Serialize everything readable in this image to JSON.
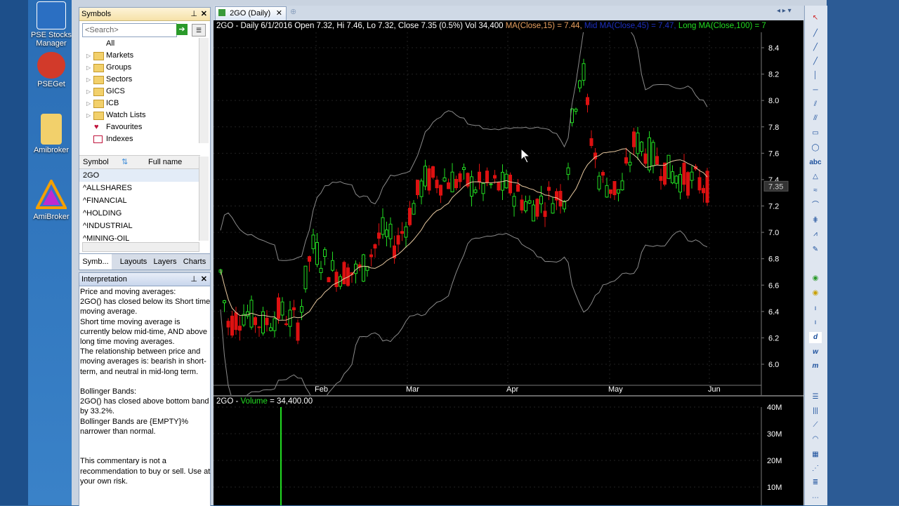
{
  "desktop": {
    "icons": [
      {
        "label": "PSE Stocks Manager",
        "color": "#2b6fc2"
      },
      {
        "label": "PSEGet",
        "color": "#d23a2a"
      },
      {
        "label": "Amibroker",
        "color": "#f2d06b"
      },
      {
        "label": "AmiBroker",
        "color": "#3a70c8"
      }
    ]
  },
  "symbols_panel": {
    "title": "Symbols",
    "search_placeholder": "<Search>",
    "tree": [
      "All",
      "Markets",
      "Groups",
      "Sectors",
      "GICS",
      "ICB",
      "Watch Lists",
      "Favourites",
      "Indexes"
    ],
    "col_symbol": "Symbol",
    "col_fullname": "Full name",
    "rows": [
      "2GO",
      "^ALLSHARES",
      "^FINANCIAL",
      "^HOLDING",
      "^INDUSTRIAL",
      "^MINING-OIL"
    ]
  },
  "tabs": [
    "Symb...",
    "Layouts",
    "Layers",
    "Charts"
  ],
  "interpretation": {
    "title": "Interpretation",
    "text": "Price and moving averages:\n2GO() has closed below its Short time moving average.\nShort time moving average is currently below mid-time, AND above long time moving averages.\nThe relationship between price and moving averages is: bearish in short-term, and neutral in mid-long term.\n\nBollinger Bands:\n2GO() has closed above bottom band by 33.2%.\nBollinger Bands are {EMPTY}% narrower than normal.\n\n\nThis commentary is not a recommendation to buy or sell. Use at your own risk."
  },
  "chart": {
    "tab_title": "2GO (Daily)",
    "header_main": "2GO - Daily 6/1/2016 Open 7.32, Hi 7.46, Lo 7.32, Close 7.35 (0.5%) Vol 34,400",
    "ma_short": "MA(Close,15) = 7.44,",
    "ma_mid": "Mid MA(Close,45) = 7.47,",
    "ma_long": "Long MA(Close,100) = 7",
    "price_tag": "7.35",
    "y_ticks": [
      "8.4",
      "8.2",
      "8.0",
      "7.8",
      "7.6",
      "7.4",
      "7.2",
      "7.0",
      "6.8",
      "6.6",
      "6.4",
      "6.2",
      "6.0"
    ],
    "x_ticks": [
      "Feb",
      "Mar",
      "Apr",
      "May",
      "Jun"
    ],
    "volume_header_prefix": "2GO -",
    "volume_label": "Volume",
    "volume_value": "= 34,400.00",
    "vol_ticks": [
      "40M",
      "30M",
      "20M",
      "10M"
    ],
    "colors": {
      "up": "#22dd22",
      "down": "#dd1111",
      "band": "#8a8a8a",
      "ma": "#e8c9a0"
    }
  },
  "chart_data": {
    "type": "candlestick",
    "title": "2GO - Daily",
    "x": [
      "Feb",
      "Mar",
      "Apr",
      "May",
      "Jun"
    ],
    "ylim": [
      5.9,
      8.5
    ],
    "last_close": 7.35,
    "volume": 34400,
    "volume_ticks": [
      "40M",
      "30M",
      "20M",
      "10M"
    ]
  }
}
